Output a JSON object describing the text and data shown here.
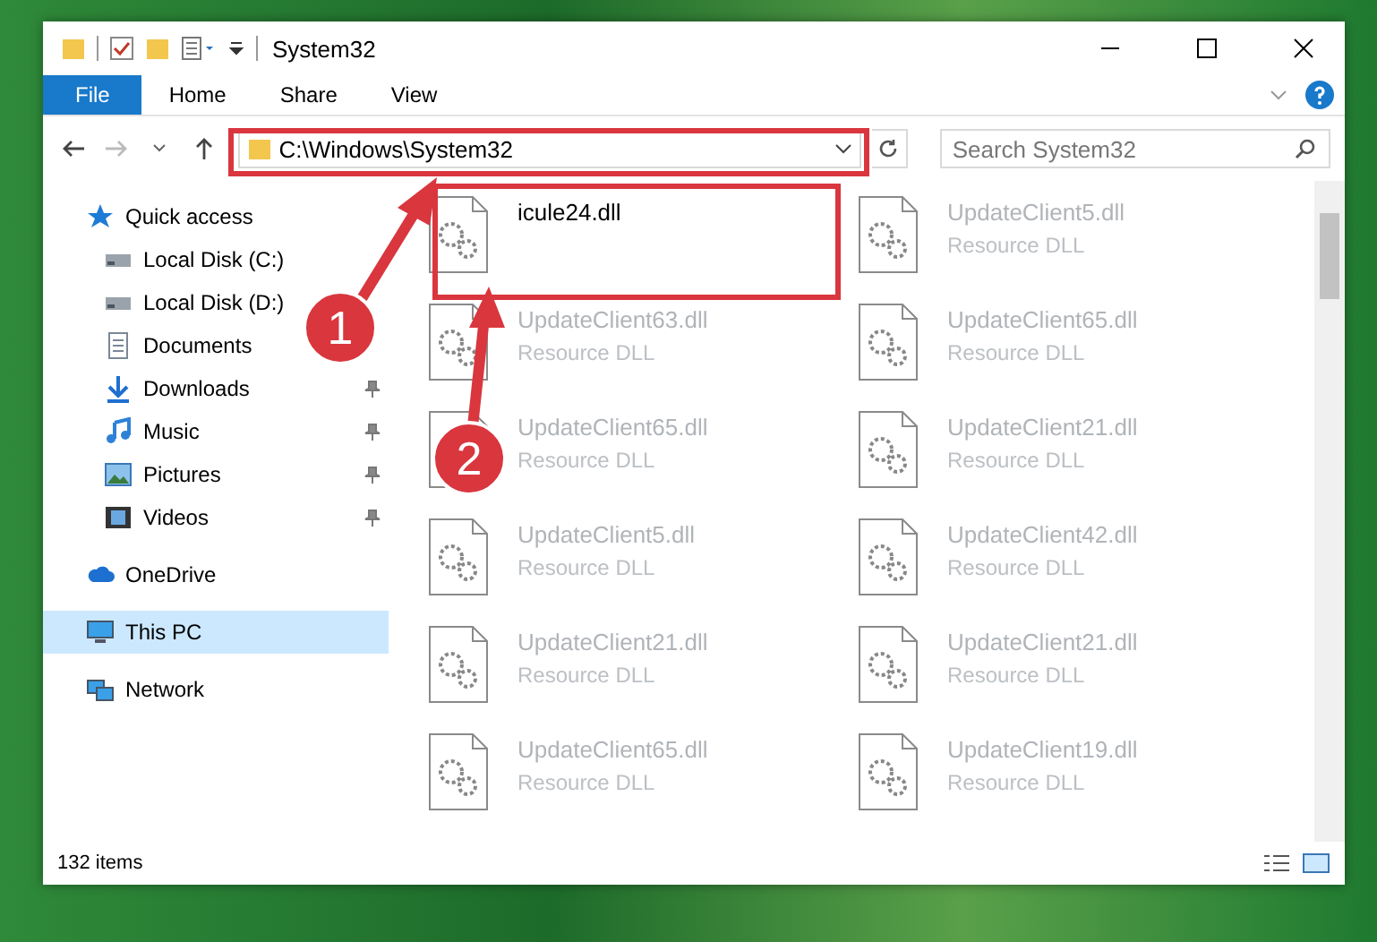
{
  "window": {
    "title": "System32"
  },
  "ribbon_tabs": [
    {
      "label": "File",
      "selected": true
    },
    {
      "label": "Home",
      "selected": false
    },
    {
      "label": "Share",
      "selected": false
    },
    {
      "label": "View",
      "selected": false
    }
  ],
  "address_bar": {
    "path": "C:\\Windows\\System32"
  },
  "search": {
    "placeholder": "Search System32"
  },
  "sidebar": {
    "items": [
      {
        "label": "Quick access",
        "selected": false,
        "children": [
          {
            "label": "Local Disk (C:)",
            "pinned": false
          },
          {
            "label": "Local Disk (D:)",
            "pinned": false
          },
          {
            "label": "Documents",
            "pinned": false
          },
          {
            "label": "Downloads",
            "pinned": true
          },
          {
            "label": "Music",
            "pinned": true
          },
          {
            "label": "Pictures",
            "pinned": true
          },
          {
            "label": "Videos",
            "pinned": true
          }
        ]
      },
      {
        "label": "OneDrive",
        "selected": false
      },
      {
        "label": "This PC",
        "selected": true
      },
      {
        "label": "Network",
        "selected": false
      }
    ]
  },
  "files": [
    {
      "name": "icule24.dll"
    },
    {
      "name": "UpdateClient5.dll",
      "type": "Resource DLL"
    },
    {
      "name": "UpdateClient63.dll",
      "type": "Resource DLL"
    },
    {
      "name": "UpdateClient65.dll",
      "type": "Resource DLL"
    },
    {
      "name": "UpdateClient65.dll",
      "type": "Resource DLL"
    },
    {
      "name": "UpdateClient21.dll",
      "type": "Resource DLL"
    },
    {
      "name": "UpdateClient5.dll",
      "type": "Resource DLL"
    },
    {
      "name": "UpdateClient42.dll",
      "type": "Resource DLL"
    },
    {
      "name": "UpdateClient21.dll",
      "type": "Resource DLL"
    },
    {
      "name": "UpdateClient21.dll",
      "type": "Resource DLL"
    },
    {
      "name": "UpdateClient65.dll",
      "type": "Resource DLL"
    },
    {
      "name": "UpdateClient19.dll",
      "type": "Resource DLL"
    }
  ],
  "status_bar": {
    "item_count": "132 items"
  },
  "callouts": [
    {
      "number": "1"
    },
    {
      "number": "2"
    }
  ]
}
